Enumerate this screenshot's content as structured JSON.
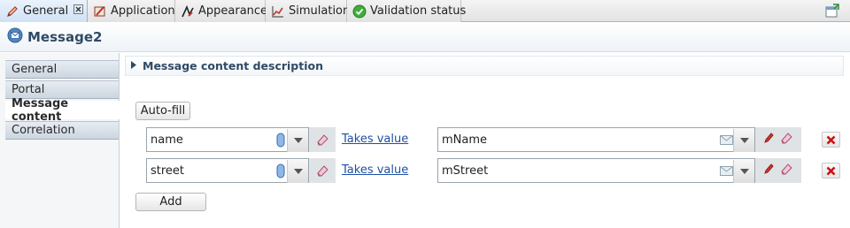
{
  "tabs": [
    {
      "label": "General",
      "icon": "pencil-icon",
      "active": true
    },
    {
      "label": "Application",
      "icon": "application-icon"
    },
    {
      "label": "Appearance",
      "icon": "appearance-icon"
    },
    {
      "label": "Simulation",
      "icon": "simulation-chart-icon"
    },
    {
      "label": "Validation status",
      "icon": "check-circle-icon"
    }
  ],
  "title": "Message2",
  "nav": {
    "items": [
      "General",
      "Portal",
      "Message content",
      "Correlation"
    ],
    "active_index": 2
  },
  "section": {
    "title": "Message content description"
  },
  "buttons": {
    "autofill": "Auto-fill",
    "add": "Add"
  },
  "rows": [
    {
      "name": "name",
      "relation": "Takes value",
      "value": "mName"
    },
    {
      "name": "street",
      "relation": "Takes value",
      "value": "mStreet"
    }
  ],
  "colors": {
    "accent": "#2f4a66",
    "link": "#1f4fa3",
    "delete": "#cc1111"
  }
}
